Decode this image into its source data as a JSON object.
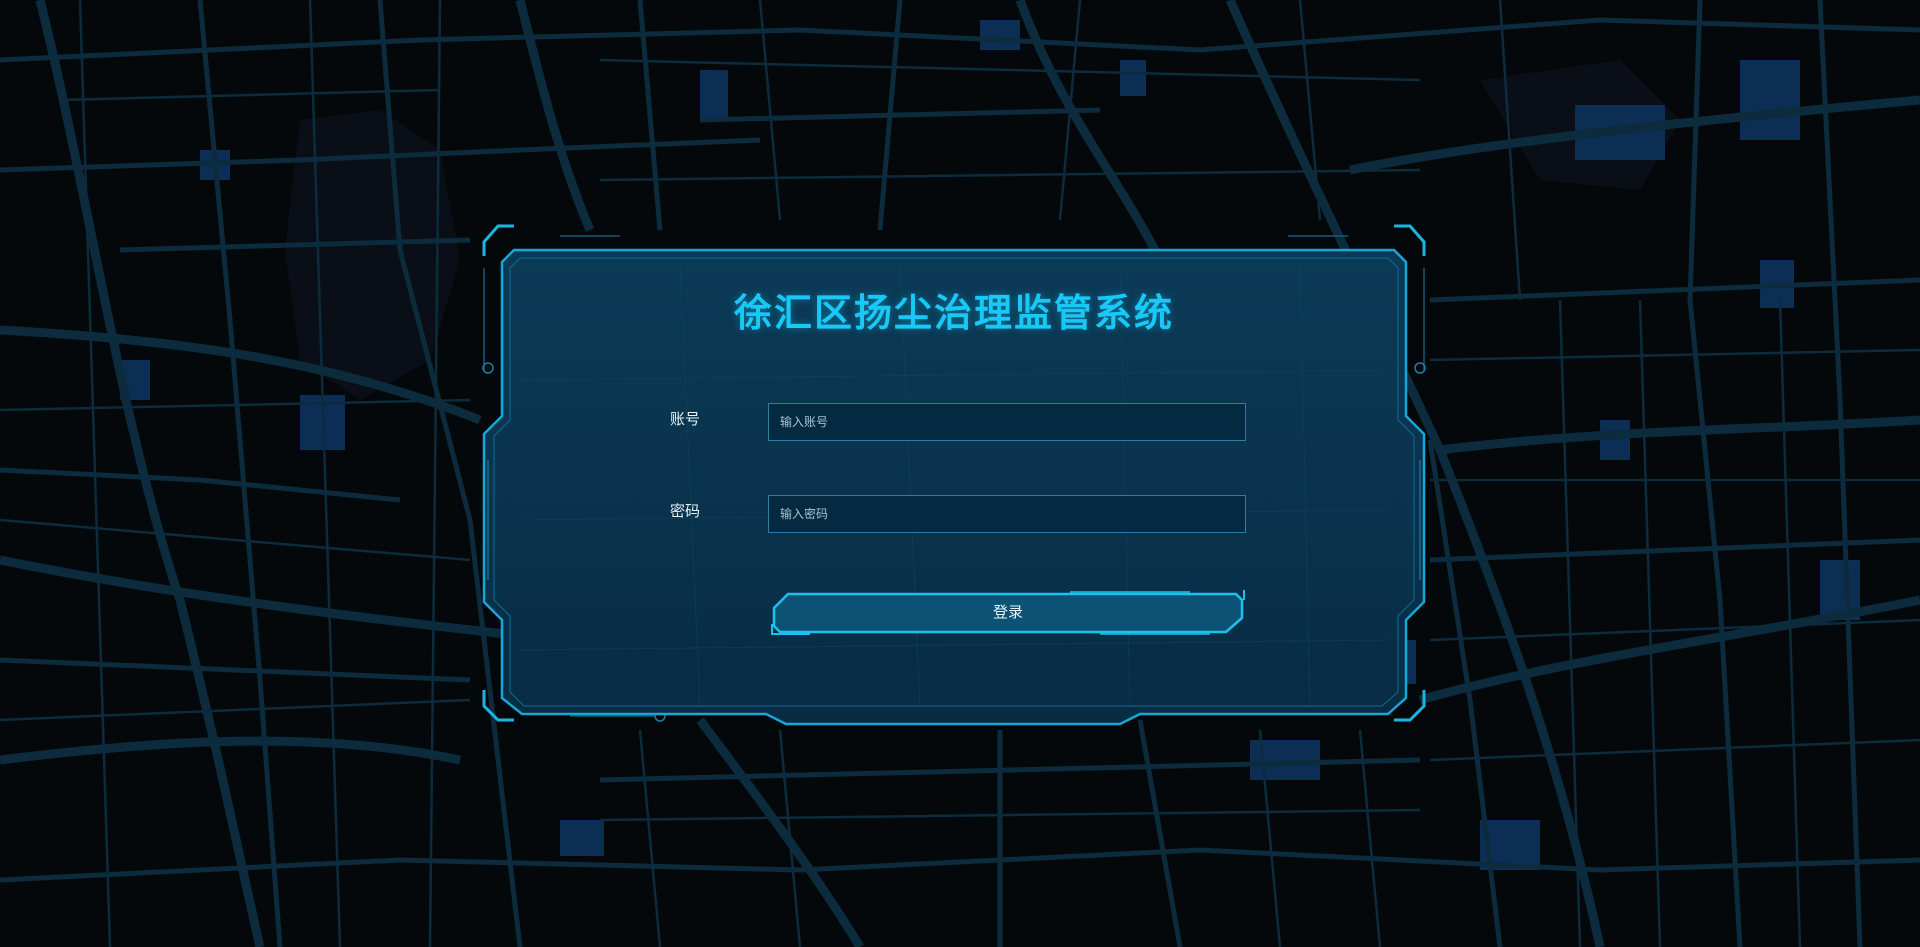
{
  "login": {
    "title": "徐汇区扬尘治理监管系统",
    "account_label": "账号",
    "account_placeholder": "输入账号",
    "account_value": "",
    "password_label": "密码",
    "password_placeholder": "输入密码",
    "password_value": "",
    "submit_label": "登录"
  },
  "colors": {
    "accent": "#18c8f6",
    "background": "#05080b",
    "panel": "#0a3550",
    "road": "#0c2b3d",
    "block": "#0c2e55"
  }
}
